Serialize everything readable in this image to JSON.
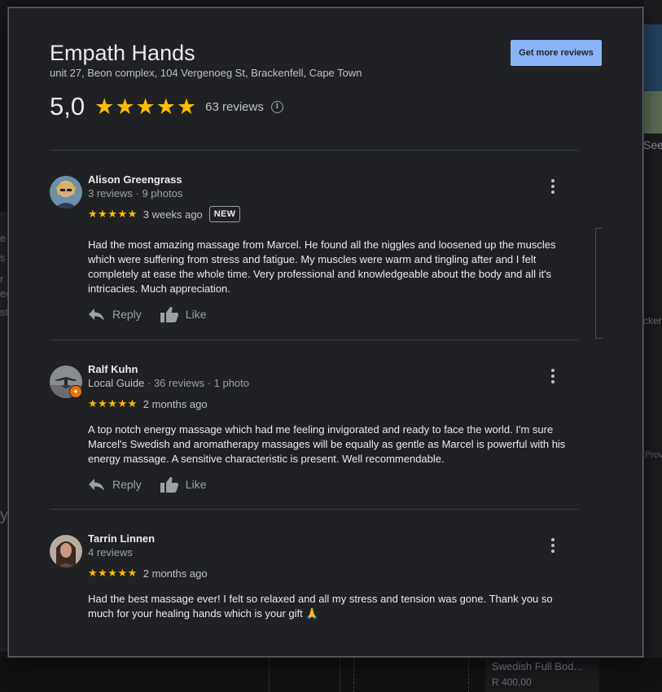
{
  "background": {
    "right_see": "See",
    "right_mid": "cker",
    "right_prov": "Prov",
    "left_fragments": [
      "e",
      "s",
      "r",
      "eg",
      "sto"
    ],
    "left_y": "y",
    "card_title": "Swedish Full Bod...",
    "card_price": "R 400,00"
  },
  "header": {
    "title": "Empath Hands",
    "address": "unit 27, Beon complex, 104 Vergenoeg St, Brackenfell, Cape Town",
    "rating": "5,0",
    "stars": "★★★★★",
    "review_count": "63 reviews",
    "info_icon": "i",
    "get_more_label": "Get more reviews"
  },
  "reviews": [
    {
      "author": "Alison Greengrass",
      "local_guide": "",
      "meta": "3 reviews · 9 photos",
      "stars": "★★★★★",
      "ago": "3 weeks ago",
      "badge": "NEW",
      "text": "Had the most amazing massage from Marcel. He found all the niggles and loosened up the muscles which were suffering from stress and fatigue. My muscles were warm and tingling after and I felt completely at ease the whole time. Very professional and knowledgeable about the body and all it's intricacies. Much appreciation.",
      "reply_label": "Reply",
      "like_label": "Like"
    },
    {
      "author": "Ralf Kuhn",
      "local_guide": "Local Guide",
      "meta": " · 36 reviews · 1 photo",
      "stars": "★★★★★",
      "ago": "2 months ago",
      "badge": "",
      "text": "A top notch energy massage which had me feeling invigorated and ready to face the world. I'm sure Marcel's Swedish and aromatherapy massages will be equally as gentle as Marcel is powerful with his energy massage. A sensitive characteristic is present. Well recommendable.",
      "reply_label": "Reply",
      "like_label": "Like"
    },
    {
      "author": "Tarrin Linnen",
      "local_guide": "",
      "meta": "4 reviews",
      "stars": "★★★★★",
      "ago": "2 months ago",
      "badge": "",
      "text": "Had the best massage ever! I felt so relaxed and all my stress and tension was gone. Thank you so much for your healing hands which is your gift 🙏",
      "reply_label": "Reply",
      "like_label": "Like"
    }
  ],
  "colors": {
    "accent": "#8ab4f8",
    "star": "#fbbc04",
    "dialog_bg": "#202124",
    "local_guide_badge": "#e8710a"
  }
}
